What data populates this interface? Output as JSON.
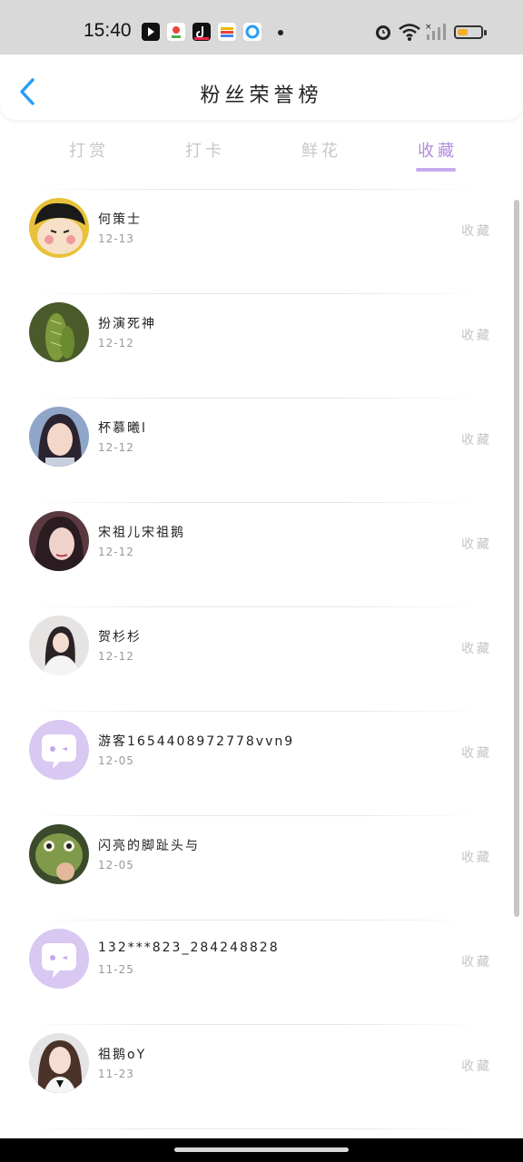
{
  "status_bar": {
    "time": "15:40",
    "app_icons": [
      "notification-app-icon",
      "maps-app-icon",
      "tiktok-app-icon",
      "wallet-app-icon",
      "browser-app-icon"
    ],
    "right_icons": [
      "alarm-icon",
      "wifi-icon",
      "signal-icon",
      "battery-icon"
    ],
    "battery_level": 0.45,
    "battery_color": "#f2b02a"
  },
  "header": {
    "title": "粉丝荣誉榜",
    "back_icon": "chevron-left-icon",
    "back_color": "#2a9df4"
  },
  "tabs": [
    {
      "label": "打赏",
      "active": false
    },
    {
      "label": "打卡",
      "active": false
    },
    {
      "label": "鲜花",
      "active": false
    },
    {
      "label": "收藏",
      "active": true
    }
  ],
  "accent_color": "#b18cdc",
  "fans": [
    {
      "name": "何策士",
      "date": "12-13",
      "action": "收藏",
      "avatar": "cartoon-avatar"
    },
    {
      "name": "扮演死神",
      "date": "12-12",
      "action": "收藏",
      "avatar": "cactus-avatar"
    },
    {
      "name": "杯慕曦l",
      "date": "12-12",
      "action": "收藏",
      "avatar": "photo-avatar"
    },
    {
      "name": "宋祖儿宋祖鹅",
      "date": "12-12",
      "action": "收藏",
      "avatar": "photo-avatar"
    },
    {
      "name": "贺杉杉",
      "date": "12-12",
      "action": "收藏",
      "avatar": "photo-avatar"
    },
    {
      "name": "游客1654408972778vvn9",
      "date": "12-05",
      "action": "收藏",
      "avatar": "default-chat-avatar"
    },
    {
      "name": "闪亮的脚趾头与",
      "date": "12-05",
      "action": "收藏",
      "avatar": "frog-avatar"
    },
    {
      "name": "132***823_284248828",
      "date": "11-25",
      "action": "收藏",
      "avatar": "default-chat-avatar"
    },
    {
      "name": "祖鹅oY",
      "date": "11-23",
      "action": "收藏",
      "avatar": "photo-avatar"
    }
  ]
}
